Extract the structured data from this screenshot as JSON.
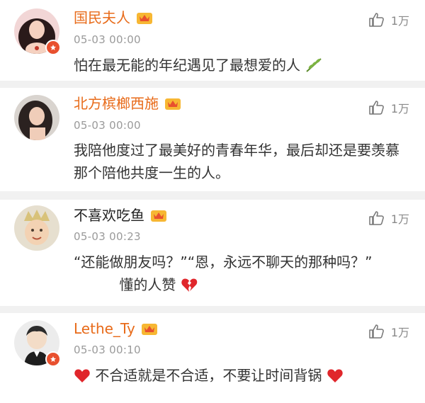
{
  "comments": [
    {
      "user": "国民夫人",
      "time": "05-03 00:00",
      "text": "怕在最无能的年纪遇见了最想爱的人",
      "likes": "1万",
      "name_style": "vip",
      "trailing_icon": "olive-branch-emoji"
    },
    {
      "user": "北方槟榔西施",
      "time": "05-03 00:00",
      "text": "我陪他度过了最美好的青春年华，最后却还是要羡慕那个陪他共度一生的人。",
      "likes": "1万",
      "name_style": "vip"
    },
    {
      "user": "不喜欢吃鱼",
      "time": "05-03 00:23",
      "text_part1": "“还能做朋友吗？”“恩，永远不聊天的那种吗？”",
      "text_part2": "懂的人赞",
      "likes": "1万",
      "name_style": "plain",
      "trailing_icon": "broken-heart-emoji"
    },
    {
      "user": "Lethe_Ty",
      "time": "05-03 00:10",
      "text": "不合适就是不合适，不要让时间背锅",
      "likes": "1万",
      "name_style": "vip",
      "leading_icon": "red-heart-emoji",
      "trailing_icon": "red-heart-emoji"
    }
  ],
  "colors": {
    "vip_name": "#e86b1a",
    "badge": "#e8502e",
    "divider": "#f1f1f1",
    "heart": "#e0262b"
  }
}
